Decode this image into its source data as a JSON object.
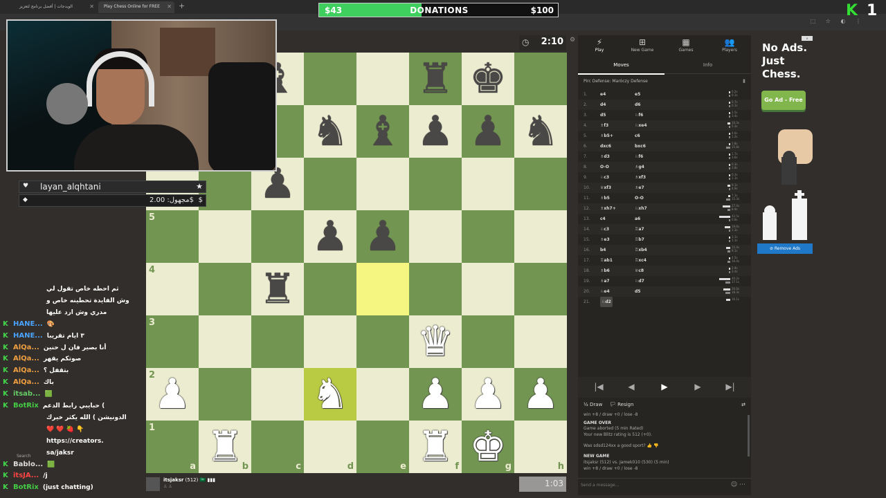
{
  "browser": {
    "tabs": [
      {
        "title": "الويدجات | أفضل برنامج لتعزيز"
      },
      {
        "title": "Play Chess Online for FREE"
      }
    ],
    "new_tab": "+"
  },
  "donations": {
    "current": "$43",
    "label": "DONATIONS",
    "goal": "$100",
    "progress": 0.43
  },
  "kick_logo": {
    "letter": "K",
    "count": "1"
  },
  "alerts": {
    "follower_name": "layan_alqhtani",
    "donation_amount": "مجهول: 2.00$",
    "donation_currency": "$"
  },
  "chat": {
    "lines": [
      {
        "user": "",
        "msg": "ثم احطه خاص تقول لي",
        "color": "#ffffff"
      },
      {
        "user": "",
        "msg": "وش الفايدة تحطينه خاص و",
        "color": "#ffffff"
      },
      {
        "user": "",
        "msg": "مدري وش ارد عليها",
        "color": "#ffffff"
      },
      {
        "user": "HANE...",
        "msg": "🎨",
        "color": "#4aa3ff"
      },
      {
        "user": "HANE...",
        "msg": "٣ ايام تقريبا",
        "color": "#4aa3ff"
      },
      {
        "user": "AlQa...",
        "msg": "أنا بصير فان ل حنين",
        "color": "#f0a040"
      },
      {
        "user": "AlQa...",
        "msg": "صوتكم يقهر",
        "color": "#f0a040"
      },
      {
        "user": "AlQa...",
        "msg": "بتقفل ؟",
        "color": "#f0a040"
      },
      {
        "user": "AlQa...",
        "msg": "باك",
        "color": "#f0a040"
      },
      {
        "user": "itsab...",
        "msg": "🟩",
        "color": "#66cc66"
      },
      {
        "user": "BotRix",
        "msg": "حبايبي رابط الدعم (",
        "color": "#44cc44"
      },
      {
        "user": "",
        "msg": "الدونيشن ) الله يكثر خيرك",
        "color": "#ffffff"
      },
      {
        "user": "",
        "msg": "❤️ ❤️ 🍓 👇",
        "color": "#ffffff"
      },
      {
        "user": "",
        "msg": "https://creators.",
        "color": "#ffffff"
      },
      {
        "user": "",
        "msg": "sa/jaksr",
        "color": "#ffffff"
      },
      {
        "user": "Bablo...",
        "msg": "🟩",
        "color": "#dddddd"
      },
      {
        "user": "itsJA...",
        "msg": "/j",
        "color": "#ff4444"
      },
      {
        "user": "BotRix",
        "msg": "(just chatting)",
        "color": "#44cc44"
      }
    ],
    "search_label": "Search"
  },
  "board": {
    "ranks": [
      "5",
      "4",
      "3",
      "2",
      "1"
    ],
    "files": [
      "a",
      "b",
      "c",
      "d",
      "e",
      "f",
      "g",
      "h"
    ],
    "pieces": [
      {
        "sq": "c8",
        "glyph": "♝",
        "color": "b"
      },
      {
        "sq": "f8",
        "glyph": "♜",
        "color": "b"
      },
      {
        "sq": "g8",
        "glyph": "♚",
        "color": "b"
      },
      {
        "sq": "d7",
        "glyph": "♞",
        "color": "b"
      },
      {
        "sq": "e7",
        "glyph": "♝",
        "color": "b"
      },
      {
        "sq": "f7",
        "glyph": "♟",
        "color": "b"
      },
      {
        "sq": "g7",
        "glyph": "♟",
        "color": "b"
      },
      {
        "sq": "h7",
        "glyph": "♞",
        "color": "b"
      },
      {
        "sq": "c6",
        "glyph": "♟",
        "color": "b"
      },
      {
        "sq": "d5",
        "glyph": "♟",
        "color": "b"
      },
      {
        "sq": "e5",
        "glyph": "♟",
        "color": "b"
      },
      {
        "sq": "c4",
        "glyph": "♜",
        "color": "b"
      },
      {
        "sq": "f3",
        "glyph": "♛",
        "color": "w"
      },
      {
        "sq": "a2",
        "glyph": "♟",
        "color": "w"
      },
      {
        "sq": "d2",
        "glyph": "♞",
        "color": "w"
      },
      {
        "sq": "f2",
        "glyph": "♟",
        "color": "w"
      },
      {
        "sq": "g2",
        "glyph": "♟",
        "color": "w"
      },
      {
        "sq": "h2",
        "glyph": "♟",
        "color": "w"
      },
      {
        "sq": "b1",
        "glyph": "♜",
        "color": "w"
      },
      {
        "sq": "f1",
        "glyph": "♜",
        "color": "w"
      },
      {
        "sq": "g1",
        "glyph": "♚",
        "color": "w"
      }
    ],
    "highlights": [
      "e4",
      "d2"
    ]
  },
  "clocks": {
    "top": "2:10",
    "bottom": "1:03"
  },
  "bottom_player": {
    "name": "itsjaksr",
    "rating": "(512)",
    "flags": "🇸🇦 ▮▮▮",
    "sub": "♙ ♙"
  },
  "sidebar": {
    "nav": [
      {
        "label": "Play",
        "icon": "⚡"
      },
      {
        "label": "New Game",
        "icon": "⊞"
      },
      {
        "label": "Games",
        "icon": "▦"
      },
      {
        "label": "Players",
        "icon": "👥"
      }
    ],
    "subtabs": [
      "Moves",
      "Info"
    ],
    "opening": "Pirc Defense: Maróczy Defense",
    "moves": [
      {
        "n": "1.",
        "w": "e4",
        "b": "e5"
      },
      {
        "n": "2.",
        "w": "d4",
        "b": "d6"
      },
      {
        "n": "3.",
        "w": "d5",
        "b": "♘f6"
      },
      {
        "n": "4.",
        "w": "♗f3",
        "b": "♘xe4"
      },
      {
        "n": "5.",
        "w": "♗b5+",
        "b": "c6"
      },
      {
        "n": "6.",
        "w": "dxc6",
        "b": "bxc6"
      },
      {
        "n": "7.",
        "w": "♗d3",
        "b": "♘f6"
      },
      {
        "n": "8.",
        "w": "O-O",
        "b": "♗g4"
      },
      {
        "n": "9.",
        "w": "♘c3",
        "b": "♗xf3"
      },
      {
        "n": "10.",
        "w": "♕xf3",
        "b": "♗e7"
      },
      {
        "n": "11.",
        "w": "♗b5",
        "b": "O-O"
      },
      {
        "n": "12.",
        "w": "♗xh7+",
        "b": "♘xh7"
      },
      {
        "n": "13.",
        "w": "c4",
        "b": "a6"
      },
      {
        "n": "14.",
        "w": "♘c3",
        "b": "♖a7"
      },
      {
        "n": "15.",
        "w": "♗e3",
        "b": "♖b7"
      },
      {
        "n": "16.",
        "w": "b4",
        "b": "♖xb4"
      },
      {
        "n": "17.",
        "w": "♖ab1",
        "b": "♖xc4"
      },
      {
        "n": "18.",
        "w": "♗b6",
        "b": "♕c8"
      },
      {
        "n": "19.",
        "w": "♗a7",
        "b": "♘d7"
      },
      {
        "n": "20.",
        "w": "♘e4",
        "b": "d5"
      },
      {
        "n": "21.",
        "w": "♘d2",
        "b": ""
      }
    ],
    "move_times": [
      "0.2s|0.1s",
      "0.7s|0.1s",
      "2.5s|3.4s",
      "10.3s|5.3s",
      "4.6s|1.2s",
      "1.8s|15.8s",
      "1.7s|3.6s",
      "0.3s|3.8s",
      "0.3s|1.1s",
      "9.1s|4.9s",
      "7.1s|15.3s",
      "27.4s|8.9s",
      "42.5s|0.8s",
      "19.6s|1.3s",
      "3.1s|1.1s",
      "15.4s|9.1s",
      "4.5s|10.4s",
      "2.9s|3.4s",
      "40.2s|17.1s",
      "26.0s|18.3s",
      "16.1s|"
    ],
    "controls": [
      "|◀",
      "◀",
      "▶",
      "▶",
      "▶|"
    ],
    "actions": {
      "draw": "½ Draw",
      "resign": "🏳 Resign"
    },
    "log": {
      "l1": "win +8 / draw +0 / lose -8",
      "l2": "GAME OVER",
      "l3": "Game aborted (5 min Rated)",
      "l4": "Your new Blitz rating is 512 (+0).",
      "l5": "Was sdsd124xx a good sport?",
      "l6": "NEW GAME",
      "l7": "itsjaksr (512) vs. Jamek010 (530) (5 min)",
      "l8": "win +8 / draw +0 / lose -8"
    },
    "send_placeholder": "Send a message..."
  },
  "ad": {
    "title_line1": "No Ads.",
    "title_line2": "Just",
    "title_line3": "Chess.",
    "button": "Go Ad - Free",
    "remove": "⊘ Remove Ads",
    "corner": "x"
  },
  "colors": {
    "light_square": "#ebecd0",
    "dark_square": "#739552",
    "highlight": "#f5f682",
    "accent_green": "#81b64c"
  }
}
